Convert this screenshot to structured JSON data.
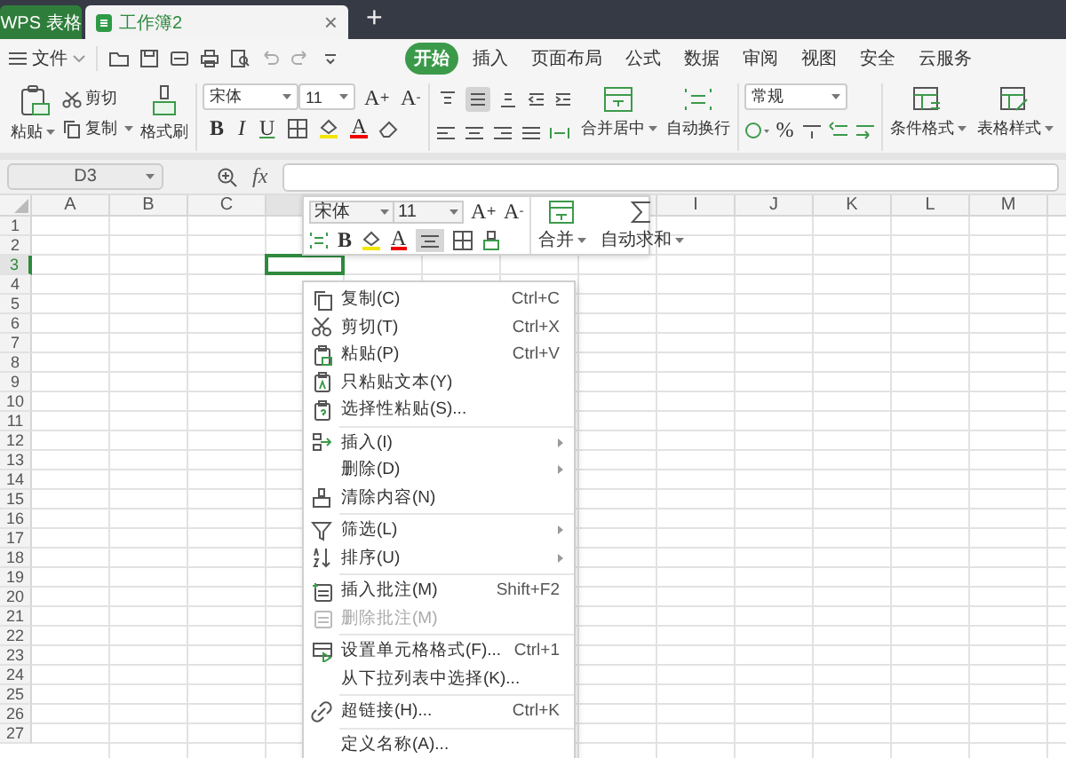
{
  "titlebar": {
    "app_tab": "WPS 表格",
    "doc_tab": "工作簿2",
    "close": "×",
    "new_tab": "+"
  },
  "menubar": {
    "file": "文件",
    "tabs": [
      {
        "label": "开始",
        "selected": true
      },
      {
        "label": "插入",
        "selected": false
      },
      {
        "label": "页面布局",
        "selected": false
      },
      {
        "label": "公式",
        "selected": false
      },
      {
        "label": "数据",
        "selected": false
      },
      {
        "label": "审阅",
        "selected": false
      },
      {
        "label": "视图",
        "selected": false
      },
      {
        "label": "安全",
        "selected": false
      },
      {
        "label": "云服务",
        "selected": false
      }
    ]
  },
  "ribbon": {
    "paste": "粘贴",
    "cut": "剪切",
    "copy": "复制",
    "format_painter": "格式刷",
    "font_name": "宋体",
    "font_size": "11",
    "grow_font": "A",
    "grow_mark": "+",
    "shrink_font": "A",
    "shrink_mark": "-",
    "bold": "B",
    "italic": "I",
    "underline": "U",
    "font_color": "A",
    "vertical_align": [
      {
        "selected": false
      },
      {
        "selected": true
      },
      {
        "selected": false
      }
    ],
    "merge": "合并居中",
    "wrap": "自动换行",
    "number_format": "常规",
    "percent": "%",
    "conditional_format": "条件格式",
    "table_style": "表格样式"
  },
  "formula_bar": {
    "name_box": "D3",
    "fx": "fx"
  },
  "grid": {
    "columns": [
      {
        "label": "A",
        "selected": false
      },
      {
        "label": "B",
        "selected": false
      },
      {
        "label": "C",
        "selected": false
      },
      {
        "selected": true
      },
      {},
      {},
      {},
      {},
      {
        "label": "I",
        "selected": false
      },
      {
        "label": "J",
        "selected": false
      },
      {
        "label": "K",
        "selected": false
      },
      {
        "label": "L",
        "selected": false
      },
      {
        "label": "M",
        "selected": false
      }
    ],
    "rows": [
      {
        "label": "1",
        "selected": false
      },
      {
        "label": "2",
        "selected": false
      },
      {
        "label": "3",
        "selected": true
      },
      {
        "label": "4",
        "selected": false
      },
      {
        "label": "5",
        "selected": false
      },
      {
        "label": "6",
        "selected": false
      },
      {
        "label": "7",
        "selected": false
      },
      {
        "label": "8",
        "selected": false
      },
      {
        "label": "9",
        "selected": false
      },
      {
        "label": "10",
        "selected": false
      },
      {
        "label": "11",
        "selected": false
      },
      {
        "label": "12",
        "selected": false
      },
      {
        "label": "13",
        "selected": false
      },
      {
        "label": "14",
        "selected": false
      },
      {
        "label": "15",
        "selected": false
      },
      {
        "label": "16",
        "selected": false
      },
      {
        "label": "17",
        "selected": false
      },
      {
        "label": "18",
        "selected": false
      },
      {
        "label": "19",
        "selected": false
      },
      {
        "label": "20",
        "selected": false
      },
      {
        "label": "21",
        "selected": false
      },
      {
        "label": "22",
        "selected": false
      },
      {
        "label": "23",
        "selected": false
      },
      {
        "label": "24",
        "selected": false
      },
      {
        "label": "25",
        "selected": false
      },
      {
        "label": "26",
        "selected": false
      },
      {
        "label": "27",
        "selected": false
      }
    ]
  },
  "mini_toolbar": {
    "font_name": "宋体",
    "font_size": "11",
    "grow_font": "A",
    "grow_mark": "+",
    "shrink_font": "A",
    "shrink_mark": "-",
    "bold": "B",
    "font_color": "A",
    "align_selected": true,
    "merge": "合并",
    "autosum": "自动求和"
  },
  "context_menu": [
    {
      "kind": "item",
      "label": "复制(C)",
      "shortcut": "Ctrl+C",
      "submenu": false,
      "disabled": false
    },
    {
      "kind": "item",
      "label": "剪切(T)",
      "shortcut": "Ctrl+X",
      "submenu": false,
      "disabled": false
    },
    {
      "kind": "item",
      "label": "粘贴(P)",
      "shortcut": "Ctrl+V",
      "submenu": false,
      "disabled": false
    },
    {
      "kind": "item",
      "label": "只粘贴文本(Y)",
      "submenu": false,
      "disabled": false
    },
    {
      "kind": "item",
      "label": "选择性粘贴(S)...",
      "submenu": false,
      "disabled": false
    },
    {
      "kind": "separator"
    },
    {
      "kind": "item",
      "label": "插入(I)",
      "submenu": true,
      "disabled": false
    },
    {
      "kind": "item",
      "label": "删除(D)",
      "submenu": true,
      "disabled": false
    },
    {
      "kind": "item",
      "label": "清除内容(N)",
      "submenu": false,
      "disabled": false
    },
    {
      "kind": "separator"
    },
    {
      "kind": "item",
      "label": "筛选(L)",
      "submenu": true,
      "disabled": false
    },
    {
      "kind": "item",
      "label": "排序(U)",
      "submenu": true,
      "disabled": false
    },
    {
      "kind": "separator"
    },
    {
      "kind": "item",
      "label": "插入批注(M)",
      "shortcut": "Shift+F2",
      "submenu": false,
      "disabled": false
    },
    {
      "kind": "item",
      "label": "删除批注(M)",
      "submenu": false,
      "disabled": true
    },
    {
      "kind": "separator"
    },
    {
      "kind": "item",
      "label": "设置单元格格式(F)...",
      "shortcut": "Ctrl+1",
      "submenu": false,
      "disabled": false
    },
    {
      "kind": "item",
      "label": "从下拉列表中选择(K)...",
      "submenu": false,
      "disabled": false
    },
    {
      "kind": "separator"
    },
    {
      "kind": "item",
      "label": "超链接(H)...",
      "shortcut": "Ctrl+K",
      "submenu": false,
      "disabled": false
    },
    {
      "kind": "separator"
    },
    {
      "kind": "item",
      "label": "定义名称(A)...",
      "submenu": false,
      "disabled": false
    }
  ]
}
